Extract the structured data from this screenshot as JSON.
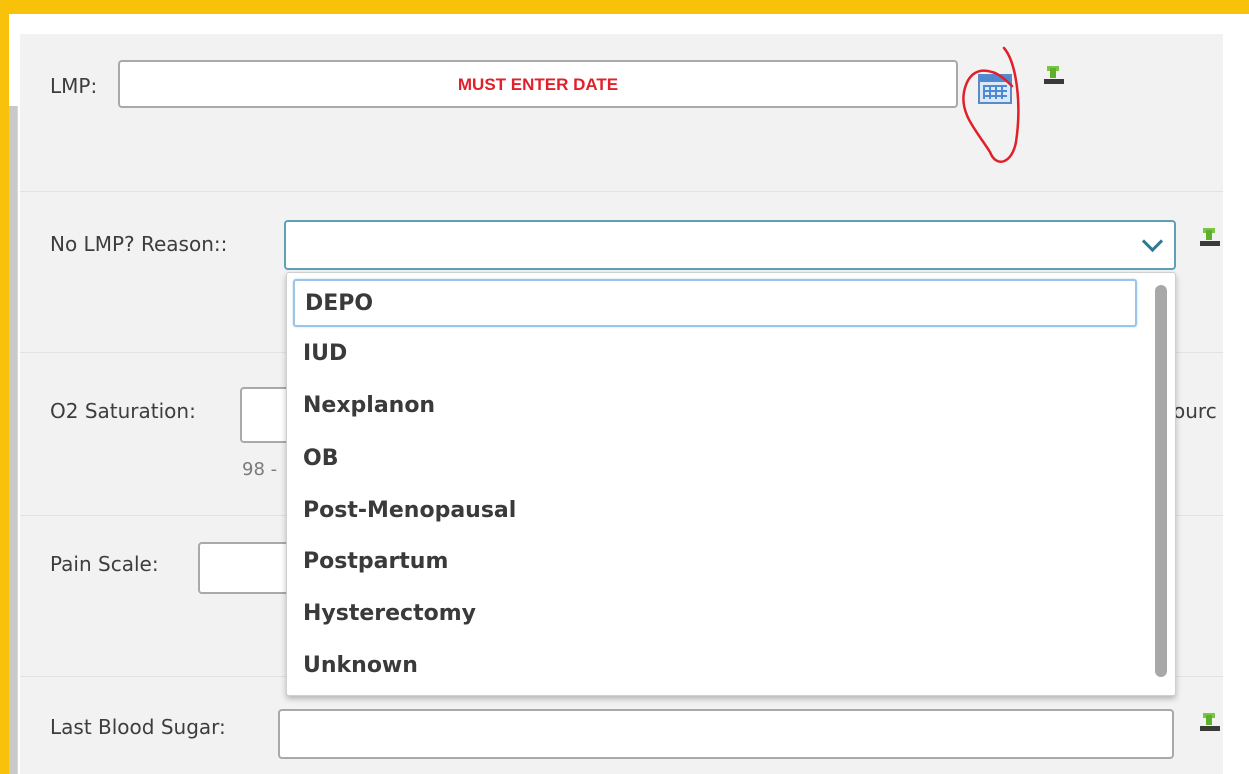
{
  "fields": {
    "lmp": {
      "label": "LMP:",
      "value_text": "MUST ENTER DATE"
    },
    "no_lmp_reason": {
      "label": "No LMP? Reason::",
      "value": ""
    },
    "o2_saturation": {
      "label": "O2 Saturation:",
      "hint": "98 -",
      "trailing_text": "ourc"
    },
    "pain_scale": {
      "label": "Pain Scale:"
    },
    "last_blood_sugar": {
      "label": "Last Blood Sugar:"
    }
  },
  "dropdown": {
    "options": [
      "DEPO",
      "IUD",
      "Nexplanon",
      "OB",
      "Post-Menopausal",
      "Postpartum",
      "Hysterectomy",
      "Unknown"
    ],
    "focused_option": "DEPO"
  },
  "colors": {
    "frame": "#f9c20a",
    "form_bg": "#f2f2f2",
    "required_text": "#e0202a",
    "annotation": "#e0202a"
  },
  "icons": {
    "calendar": "calendar-icon",
    "default_value": "insert-default-icon",
    "chevron": "chevron-down-icon"
  }
}
